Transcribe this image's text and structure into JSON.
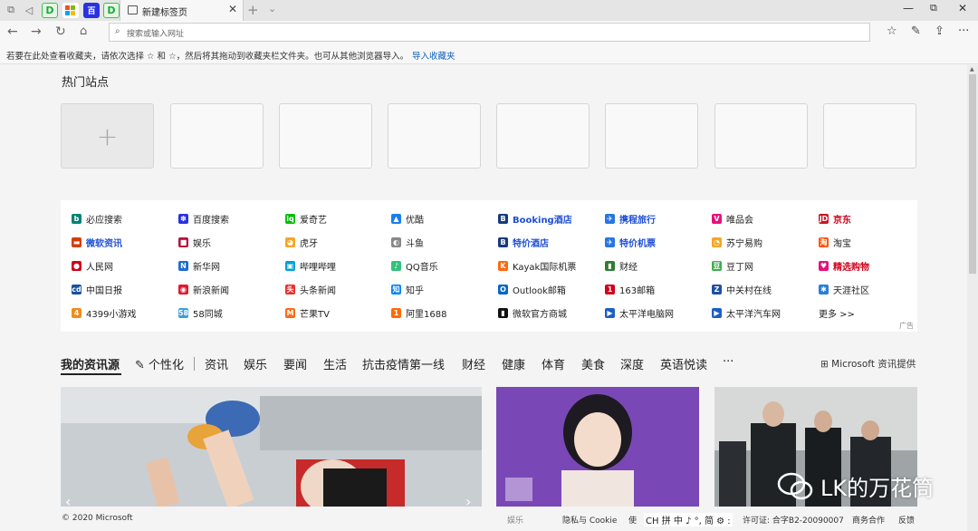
{
  "browser": {
    "tab_title": "新建标签页",
    "address_placeholder": "搜索或输入网址",
    "pinned_tabs": [
      "D",
      "M",
      "百",
      "D"
    ]
  },
  "favbar": {
    "hint": "若要在此处查看收藏夹，请依次选择 ☆ 和 ☆，然后将其拖动到收藏夹栏文件夹。也可从其他浏览器导入。",
    "import_label": "导入收藏夹"
  },
  "hot_sites": {
    "title": "热门站点",
    "add_symbol": "+"
  },
  "links": [
    [
      {
        "label": "必应搜索",
        "style": "normal",
        "icon_color": "#008373",
        "glyph": "b"
      },
      {
        "label": "微软资讯",
        "style": "bold-blue",
        "icon_color": "#d83b01",
        "glyph": "▬"
      },
      {
        "label": "人民网",
        "style": "normal",
        "icon_color": "#d0021b",
        "glyph": "●"
      },
      {
        "label": "中国日报",
        "style": "normal",
        "icon_color": "#1a4fa0",
        "glyph": "cd"
      },
      {
        "label": "4399小游戏",
        "style": "normal",
        "icon_color": "#f08c1c",
        "glyph": "4"
      }
    ],
    [
      {
        "label": "百度搜索",
        "style": "normal",
        "icon_color": "#2932e1",
        "glyph": "✽"
      },
      {
        "label": "娱乐",
        "style": "normal",
        "icon_color": "#b5123b",
        "glyph": "■"
      },
      {
        "label": "新华网",
        "style": "normal",
        "icon_color": "#1d6bd6",
        "glyph": "N"
      },
      {
        "label": "新浪新闻",
        "style": "normal",
        "icon_color": "#e6162d",
        "glyph": "◉"
      },
      {
        "label": "58同城",
        "style": "normal",
        "icon_color": "#3a9de0",
        "glyph": "58"
      }
    ],
    [
      {
        "label": "爱奇艺",
        "style": "normal",
        "icon_color": "#00be06",
        "glyph": "iq"
      },
      {
        "label": "虎牙",
        "style": "normal",
        "icon_color": "#f5a623",
        "glyph": "◕"
      },
      {
        "label": "哔哩哔哩",
        "style": "normal",
        "icon_color": "#00a1d6",
        "glyph": "▣"
      },
      {
        "label": "头条新闻",
        "style": "normal",
        "icon_color": "#e8302e",
        "glyph": "头"
      },
      {
        "label": "芒果TV",
        "style": "normal",
        "icon_color": "#f46e18",
        "glyph": "M"
      }
    ],
    [
      {
        "label": "优酷",
        "style": "normal",
        "icon_color": "#1a7de8",
        "glyph": "▲"
      },
      {
        "label": "斗鱼",
        "style": "normal",
        "icon_color": "#888888",
        "glyph": "◐"
      },
      {
        "label": "QQ音乐",
        "style": "normal",
        "icon_color": "#31c27c",
        "glyph": "♪"
      },
      {
        "label": "知乎",
        "style": "normal",
        "icon_color": "#0084ff",
        "glyph": "知"
      },
      {
        "label": "阿里1688",
        "style": "normal",
        "icon_color": "#ff6a00",
        "glyph": "1"
      }
    ],
    [
      {
        "label": "Booking酒店",
        "style": "bold-blue",
        "icon_color": "#173b7a",
        "glyph": "B"
      },
      {
        "label": "特价酒店",
        "style": "bold-blue",
        "icon_color": "#173b7a",
        "glyph": "B"
      },
      {
        "label": "Kayak国际机票",
        "style": "normal",
        "icon_color": "#ff690f",
        "glyph": "K"
      },
      {
        "label": "Outlook邮箱",
        "style": "normal",
        "icon_color": "#0a64c8",
        "glyph": "O"
      },
      {
        "label": "微软官方商城",
        "style": "normal",
        "icon_color": "#111111",
        "glyph": "▮"
      }
    ],
    [
      {
        "label": "携程旅行",
        "style": "bold-blue",
        "icon_color": "#2577e3",
        "glyph": "✈"
      },
      {
        "label": "特价机票",
        "style": "bold-blue",
        "icon_color": "#2577e3",
        "glyph": "✈"
      },
      {
        "label": "财经",
        "style": "normal",
        "icon_color": "#2e7d32",
        "glyph": "▮"
      },
      {
        "label": "163邮箱",
        "style": "normal",
        "icon_color": "#d0021b",
        "glyph": "1"
      },
      {
        "label": "太平洋电脑网",
        "style": "normal",
        "icon_color": "#1d5ec4",
        "glyph": "▶"
      }
    ],
    [
      {
        "label": "唯品会",
        "style": "normal",
        "icon_color": "#e5127d",
        "glyph": "V"
      },
      {
        "label": "苏宁易购",
        "style": "normal",
        "icon_color": "#f5a623",
        "glyph": "◔"
      },
      {
        "label": "豆丁网",
        "style": "normal",
        "icon_color": "#3dae49",
        "glyph": "豆"
      },
      {
        "label": "中关村在线",
        "style": "normal",
        "icon_color": "#1d4fa3",
        "glyph": "Z"
      },
      {
        "label": "太平洋汽车网",
        "style": "normal",
        "icon_color": "#1d5ec4",
        "glyph": "▶"
      }
    ],
    [
      {
        "label": "京东",
        "style": "bold-red",
        "icon_color": "#c81623",
        "glyph": "JD"
      },
      {
        "label": "淘宝",
        "style": "normal",
        "icon_color": "#ff5000",
        "glyph": "淘"
      },
      {
        "label": "精选购物",
        "style": "bold-red",
        "icon_color": "#e5127d",
        "glyph": "♥"
      },
      {
        "label": "天涯社区",
        "style": "normal",
        "icon_color": "#2a7fd4",
        "glyph": "✱"
      },
      {
        "label": "更多 >>",
        "style": "normal",
        "icon_color": "",
        "glyph": ""
      }
    ]
  ],
  "ad_label": "广告",
  "news_nav": {
    "items": [
      "我的资讯源",
      "个性化",
      "资讯",
      "娱乐",
      "要闻",
      "生活",
      "抗击疫情第一线",
      "财经",
      "健康",
      "体育",
      "美食",
      "深度",
      "英语悦读",
      "···"
    ],
    "provider": "Microsoft 资讯提供"
  },
  "footer": {
    "copyright": "© 2020 Microsoft",
    "privacy": "隐私与 Cookie",
    "license": "许可证: 合字B2-20090007",
    "business": "商务合作",
    "feedback": "反馈",
    "use": "使",
    "caption": "娱乐"
  },
  "ime_bar": "CH 拼 中 ♪ °, 简 ⚙ :",
  "watermark": "LK的万花筒",
  "colors": {
    "accent": "#0a5fc2",
    "bold_link": "#1e4fd6",
    "red_link": "#d0021b"
  }
}
